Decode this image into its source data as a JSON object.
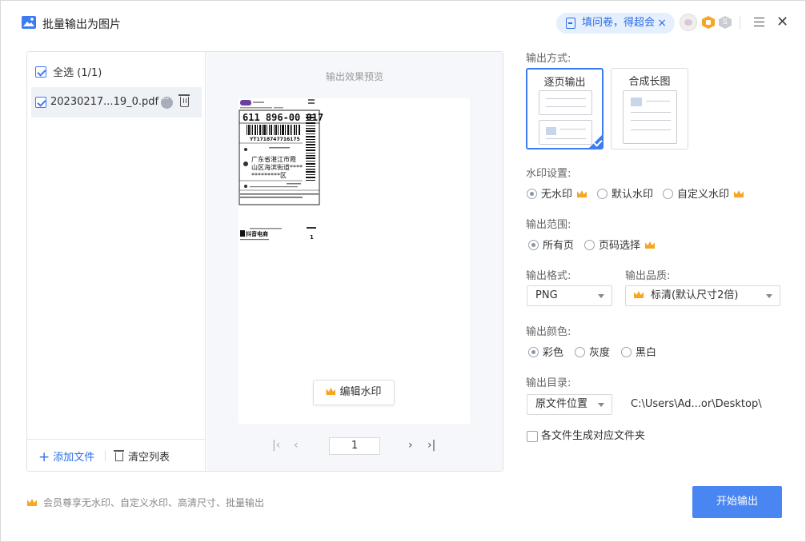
{
  "window": {
    "title": "批量输出为图片"
  },
  "header": {
    "survey_label": "填问卷，得超会",
    "survey_close": "×",
    "badge_s": "S"
  },
  "file_list": {
    "select_all_label": "全选 (1/1)",
    "files": [
      {
        "name": "20230217...19_0.pdf",
        "checked": true
      }
    ],
    "add_file_label": "添加文件",
    "clear_list_label": "清空列表"
  },
  "preview": {
    "title": "输出效果预览",
    "edit_watermark_label": "编辑水印",
    "current_page": "1",
    "label": {
      "tracking": "611 896-00 017",
      "waybill": "YT1718747716175",
      "address_line1": "广东省湛江市霞",
      "address_line2": "山区海滨街道****",
      "address_line3": "*********区",
      "brand": "抖音电商",
      "qty": "1"
    }
  },
  "settings": {
    "output_mode_label": "输出方式:",
    "mode_per_page": "逐页输出",
    "mode_long_image": "合成长图",
    "watermark_label": "水印设置:",
    "watermark_none": "无水印",
    "watermark_default": "默认水印",
    "watermark_custom": "自定义水印",
    "range_label": "输出范围:",
    "range_all": "所有页",
    "range_select": "页码选择",
    "format_label": "输出格式:",
    "format_value": "PNG",
    "quality_label": "输出品质:",
    "quality_value": "标清(默认尺寸2倍)",
    "color_label": "输出颜色:",
    "color_full": "彩色",
    "color_gray": "灰度",
    "color_bw": "黑白",
    "dir_label": "输出目录:",
    "dir_value": "原文件位置",
    "dir_path": "C:\\Users\\Ad...or\\Desktop\\",
    "per_file_folder_label": "各文件生成对应文件夹"
  },
  "footer": {
    "promo_text": "会员尊享无水印、自定义水印、高清尺寸、批量输出",
    "start_label": "开始输出"
  },
  "colors": {
    "accent": "#4a86f2",
    "crown": "#f5a623",
    "survey_bg": "#e6effd"
  }
}
